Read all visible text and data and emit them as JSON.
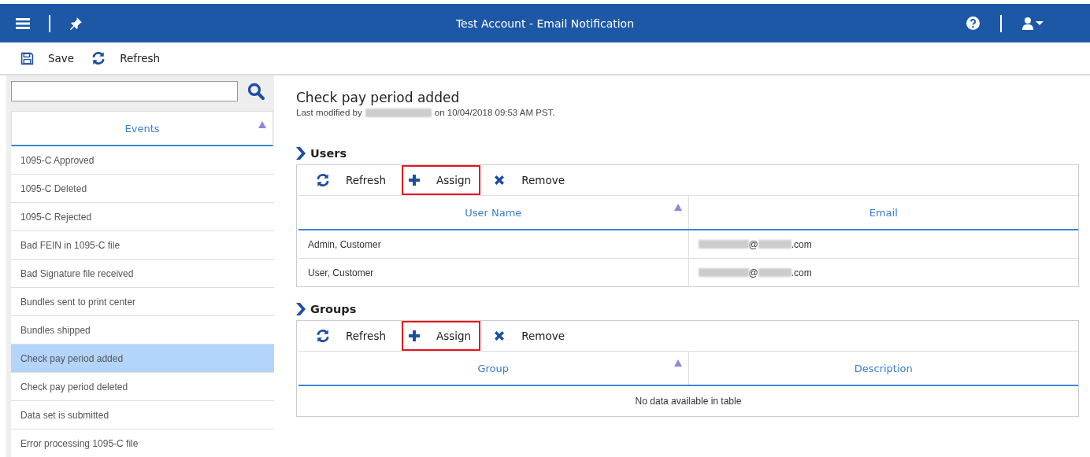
{
  "window": {
    "title": "Test Account - Email Notification"
  },
  "toolbar": [
    {
      "kind": "save",
      "label": "Save"
    },
    {
      "kind": "refresh",
      "label": "Refresh"
    }
  ],
  "sidebar": {
    "header": "Events",
    "items": [
      {
        "label": "1095-C Approved",
        "selected": false
      },
      {
        "label": "1095-C Deleted",
        "selected": false
      },
      {
        "label": "1095-C Rejected",
        "selected": false
      },
      {
        "label": "Bad FEIN in 1095-C file",
        "selected": false
      },
      {
        "label": "Bad Signature file received",
        "selected": false
      },
      {
        "label": "Bundles sent to print center",
        "selected": false
      },
      {
        "label": "Bundles shipped",
        "selected": false
      },
      {
        "label": "Check pay period added",
        "selected": true
      },
      {
        "label": "Check pay period deleted",
        "selected": false
      },
      {
        "label": "Data set is submitted",
        "selected": false
      },
      {
        "label": "Error processing 1095-C file",
        "selected": false
      }
    ]
  },
  "detail": {
    "title": "Check pay period added",
    "modified_prefix": "Last modified by",
    "modified_suffix": "on 10/04/2018 09:53 AM PST."
  },
  "sections": [
    {
      "title": "Users",
      "actions": [
        {
          "kind": "refresh",
          "label": "Refresh",
          "highlighted": false
        },
        {
          "kind": "assign",
          "label": "Assign",
          "highlighted": true
        },
        {
          "kind": "remove",
          "label": "Remove",
          "highlighted": false
        }
      ],
      "columns": [
        "User Name",
        "Email"
      ],
      "rows": [
        {
          "name": "Admin, Customer",
          "email_parts": [
            "@",
            ".com"
          ]
        },
        {
          "name": "User, Customer",
          "email_parts": [
            "@",
            ".com"
          ]
        }
      ]
    },
    {
      "title": "Groups",
      "actions": [
        {
          "kind": "refresh",
          "label": "Refresh",
          "highlighted": false
        },
        {
          "kind": "assign",
          "label": "Assign",
          "highlighted": true
        },
        {
          "kind": "remove",
          "label": "Remove",
          "highlighted": false
        }
      ],
      "columns": [
        "Group",
        "Description"
      ],
      "empty_message": "No data available in table"
    }
  ]
}
